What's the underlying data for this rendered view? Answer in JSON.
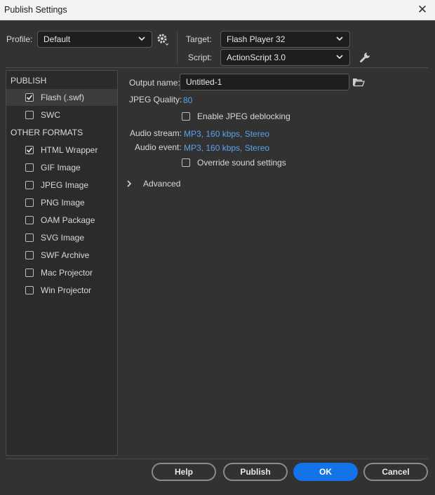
{
  "window": {
    "title": "Publish Settings"
  },
  "profile": {
    "label": "Profile:",
    "value": "Default"
  },
  "target": {
    "label": "Target:",
    "value": "Flash Player 32"
  },
  "script": {
    "label": "Script:",
    "value": "ActionScript 3.0"
  },
  "formats": {
    "publish_header": "PUBLISH",
    "publish_items": [
      {
        "label": "Flash (.swf)",
        "checked": true,
        "selected": true
      },
      {
        "label": "SWC",
        "checked": false,
        "selected": false
      }
    ],
    "other_header": "OTHER FORMATS",
    "other_items": [
      {
        "label": "HTML Wrapper",
        "checked": true
      },
      {
        "label": "GIF Image",
        "checked": false
      },
      {
        "label": "JPEG Image",
        "checked": false
      },
      {
        "label": "PNG Image",
        "checked": false
      },
      {
        "label": "OAM Package",
        "checked": false
      },
      {
        "label": "SVG Image",
        "checked": false
      },
      {
        "label": "SWF Archive",
        "checked": false
      },
      {
        "label": "Mac Projector",
        "checked": false
      },
      {
        "label": "Win Projector",
        "checked": false
      }
    ]
  },
  "settings": {
    "output_name_label": "Output name:",
    "output_name_value": "Untitled-1",
    "jpeg_quality_label": "JPEG Quality:",
    "jpeg_quality_value": "80",
    "jpeg_deblocking_label": "Enable JPEG deblocking",
    "jpeg_deblocking_checked": false,
    "audio_stream_label": "Audio stream:",
    "audio_stream_value": "MP3, 160 kbps, Stereo",
    "audio_event_label": "Audio event:",
    "audio_event_value": "MP3, 160 kbps, Stereo",
    "override_sound_label": "Override sound settings",
    "override_sound_checked": false,
    "advanced_label": "Advanced"
  },
  "buttons": {
    "help": "Help",
    "publish": "Publish",
    "ok": "OK",
    "cancel": "Cancel"
  },
  "icons": {
    "close": "close-icon",
    "profile_options": "gear-icon",
    "script_settings": "wrench-icon",
    "browse": "folder-icon",
    "advanced_toggle": "chevron-right-icon",
    "dropdown": "chevron-down-icon"
  },
  "colors": {
    "primary_button": "#1473e6",
    "link": "#5aa2ee"
  }
}
